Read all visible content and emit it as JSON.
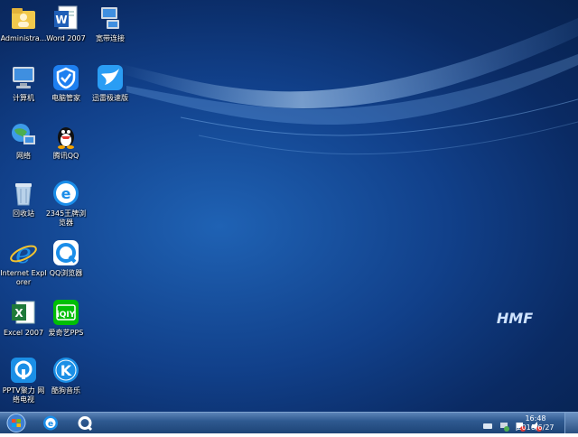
{
  "desktop": {
    "icons": [
      {
        "label": "Administra...",
        "icon": "user-folder-icon"
      },
      {
        "label": "Word 2007",
        "icon": "word-icon"
      },
      {
        "label": "宽带连接",
        "icon": "broadband-icon"
      },
      {
        "label": "计算机",
        "icon": "computer-icon"
      },
      {
        "label": "电脑管家",
        "icon": "pc-manager-icon"
      },
      {
        "label": "迅雷极速版",
        "icon": "xunlei-icon"
      },
      {
        "label": "网络",
        "icon": "network-icon"
      },
      {
        "label": "腾讯QQ",
        "icon": "qq-icon"
      },
      {
        "label": "回收站",
        "icon": "recycle-bin-icon"
      },
      {
        "label": "2345王牌浏览器",
        "icon": "2345-browser-icon"
      },
      {
        "label": "Internet Explorer",
        "icon": "ie-icon"
      },
      {
        "label": "QQ浏览器",
        "icon": "qq-browser-icon"
      },
      {
        "label": "Excel 2007",
        "icon": "excel-icon"
      },
      {
        "label": "爱奇艺PPS",
        "icon": "iqiyi-icon"
      },
      {
        "label": "PPTV聚力 网络电视",
        "icon": "pptv-icon"
      },
      {
        "label": "酷狗音乐",
        "icon": "kugou-icon"
      }
    ],
    "logo_text": "HMF"
  },
  "taskbar": {
    "start_icon": "windows-start-icon",
    "pinned": [
      "ie-taskbar-icon",
      "qq-browser-taskbar-icon"
    ],
    "tray": [
      "keyboard-icon",
      "network-tray-icon",
      "flag-icon",
      "volume-muted-icon"
    ],
    "time": "16:48",
    "date": "2016/6/27"
  },
  "colors": {
    "desktop_bg": "#11408a",
    "taskbar": "#2f5a91"
  }
}
